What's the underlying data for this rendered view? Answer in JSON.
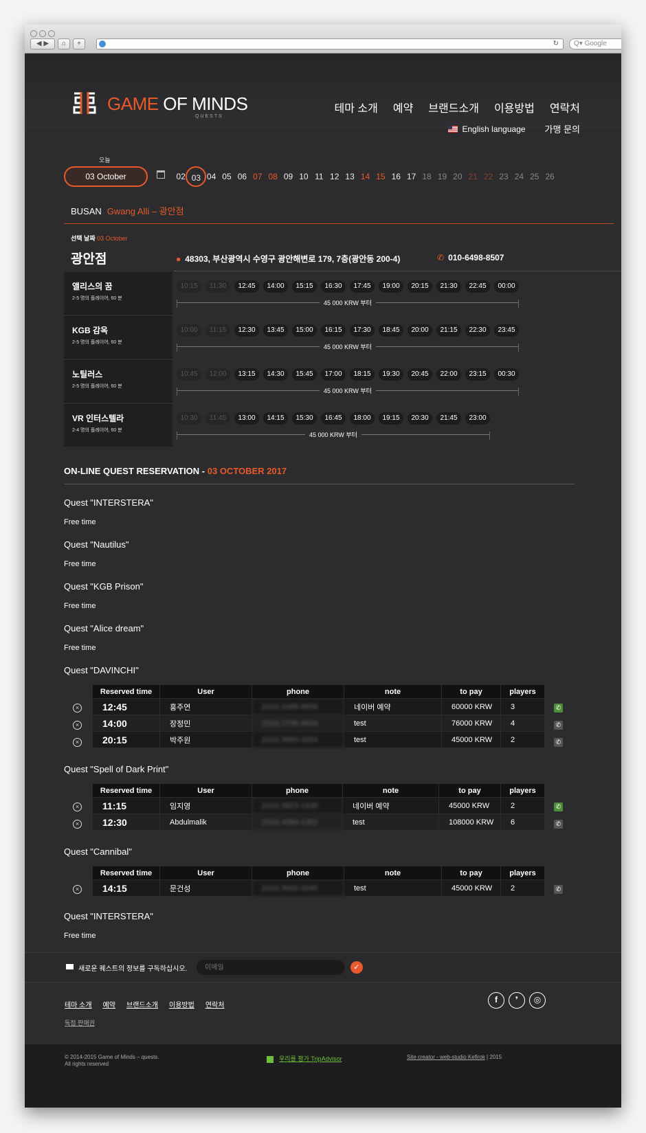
{
  "browser": {
    "search_placeholder": "Google"
  },
  "header": {
    "logo_main": "GAME",
    "logo_of": " OF ",
    "logo_minds": "MINDS",
    "logo_sub": "QUESTS",
    "nav": [
      "테마 소개",
      "예약",
      "브랜드소개",
      "이용방법",
      "연락처"
    ],
    "english": "English language",
    "join": "가맹 문의"
  },
  "datebar": {
    "today_label": "오늘",
    "current": "03 October",
    "days": [
      "02",
      "03",
      "04",
      "05",
      "06",
      "07",
      "08",
      "09",
      "10",
      "11",
      "12",
      "13",
      "14",
      "15",
      "16",
      "17",
      "18",
      "19",
      "20",
      "21",
      "22",
      "23",
      "24",
      "25",
      "26"
    ]
  },
  "location": {
    "city": "BUSAN",
    "branch_link": "Gwang Alli – 광안점",
    "selected_label": "선택 날짜",
    "selected_date": "03 October",
    "branch_name": "광안점",
    "address": "48303, 부산광역시 수영구 광안해변로 179, 7층(광안동 200-4)",
    "phone": "010-6498-8507"
  },
  "quests": [
    {
      "name": "앨리스의 꿈",
      "desc": "2-5 명의 플레이어, 60 분",
      "past": [
        "10:15",
        "11:30"
      ],
      "slots": [
        "12:45",
        "14:00",
        "15:15",
        "16:30",
        "17:45",
        "19:00",
        "20:15",
        "21:30",
        "22:45",
        "00:00"
      ],
      "price": "45 000 KRW 부터"
    },
    {
      "name": "KGB 감옥",
      "desc": "2-5 명의 플레이어, 60 분",
      "past": [
        "10:00",
        "11:15"
      ],
      "slots": [
        "12:30",
        "13:45",
        "15:00",
        "16:15",
        "17:30",
        "18:45",
        "20:00",
        "21:15",
        "22:30",
        "23:45"
      ],
      "price": "45 000 KRW 부터"
    },
    {
      "name": "노틸러스",
      "desc": "2-5 명의 플레이어, 60 분",
      "past": [
        "10:45",
        "12:00"
      ],
      "slots": [
        "13:15",
        "14:30",
        "15:45",
        "17:00",
        "18:15",
        "19:30",
        "20:45",
        "22:00",
        "23:15",
        "00:30"
      ],
      "price": "45 000 KRW 부터"
    },
    {
      "name": "VR 인터스텔라",
      "desc": "2-4 명의 플레이어, 60 분",
      "past": [
        "10:30",
        "11:45"
      ],
      "slots": [
        "13:00",
        "14:15",
        "15:30",
        "16:45",
        "18:00",
        "19:15",
        "20:30",
        "21:45",
        "23:00"
      ],
      "price": "45 000 KRW 부터"
    }
  ],
  "reservation": {
    "title": "ON-LINE QUEST RESERVATION - ",
    "date": "03 OCTOBER 2017",
    "free_time": "Free time",
    "columns": [
      "Reserved time",
      "User",
      "phone",
      "note",
      "to pay",
      "players"
    ],
    "free_quests": [
      "Quest \"INTERSTERA\"",
      "Quest \"Nautilus\"",
      "Quest \"KGB Prison\"",
      "Quest \"Alice dream\""
    ],
    "davinchi": {
      "title": "Quest \"DAVINCHI\"",
      "rows": [
        {
          "time": "12:45",
          "user": "홍주연",
          "phone": "(010) 2486-9656",
          "note": "네이버 예약",
          "pay": "60000 KRW",
          "players": "3"
        },
        {
          "time": "14:00",
          "user": "장정민",
          "phone": "(010) 2736-4004",
          "note": "test",
          "pay": "76000 KRW",
          "players": "4"
        },
        {
          "time": "20:15",
          "user": "박주원",
          "phone": "(010) 9990-3254",
          "note": "test",
          "pay": "45000 KRW",
          "players": "2"
        }
      ]
    },
    "spell": {
      "title": "Quest \"Spell of Dark Print\"",
      "rows": [
        {
          "time": "11:15",
          "user": "임지영",
          "phone": "(010) 8823-1438",
          "note": "네이버 예약",
          "pay": "45000 KRW",
          "players": "2"
        },
        {
          "time": "12:30",
          "user": "Abdulmalik",
          "phone": "(010) 4084-1352",
          "note": "test",
          "pay": "108000 KRW",
          "players": "6"
        }
      ]
    },
    "cannibal": {
      "title": "Quest \"Cannibal\"",
      "rows": [
        {
          "time": "14:15",
          "user": "문건성",
          "phone": "(010) 9000-4340",
          "note": "test",
          "pay": "45000 KRW",
          "players": "2"
        }
      ]
    },
    "last": "Quest \"INTERSTERA\""
  },
  "subscribe": {
    "label": "새로운 퀘스트의 정보를 구독하십시오.",
    "placeholder": "이메일"
  },
  "footer": {
    "nav": [
      "테마 소개",
      "예약",
      "브랜드소개",
      "이용방법",
      "연락처"
    ],
    "dealer": "독점 판매권",
    "social": [
      "f",
      "❜",
      "◎"
    ],
    "copy1": "© 2014-2015 Game of Minds – quests.",
    "copy2": "All rights reserved",
    "trip": "우리를 평가 TripAdvisor",
    "creator": "Site creator - web-studio Kefirok",
    "creator_year": " | 2015"
  }
}
